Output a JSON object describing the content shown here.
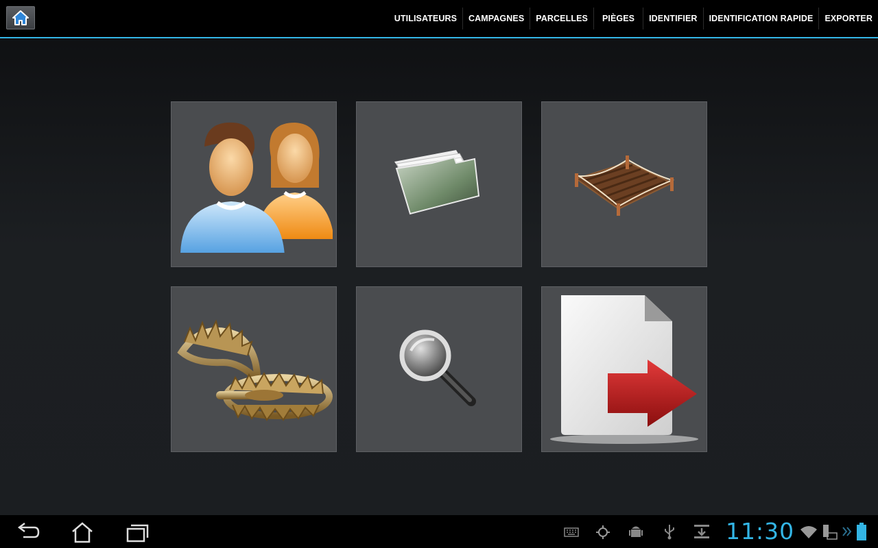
{
  "action_bar": {
    "home_icon": "home-icon",
    "accent_color": "#33b5e5",
    "menu": [
      {
        "label": "UTILISATEURS"
      },
      {
        "label": "CAMPAGNES"
      },
      {
        "label": "PARCELLES"
      },
      {
        "label": "PIÈGES"
      },
      {
        "label": "IDENTIFIER"
      },
      {
        "label": "IDENTIFICATION RAPIDE"
      },
      {
        "label": "EXPORTER"
      }
    ]
  },
  "tiles": [
    {
      "icon": "users-icon"
    },
    {
      "icon": "folder-icon"
    },
    {
      "icon": "plot-icon"
    },
    {
      "icon": "trap-icon"
    },
    {
      "icon": "magnifier-icon"
    },
    {
      "icon": "export-icon"
    }
  ],
  "system_bar": {
    "back_icon": "back-icon",
    "home_icon": "home-nav-icon",
    "recents_icon": "recent-apps-icon",
    "clock": "11:30",
    "status_icons": [
      "keyboard-icon",
      "gps-icon",
      "android-debug-icon",
      "usb-icon",
      "download-icon",
      "wifi-icon",
      "keyboard-battery-icon",
      "chevron-icon",
      "battery-icon"
    ]
  }
}
